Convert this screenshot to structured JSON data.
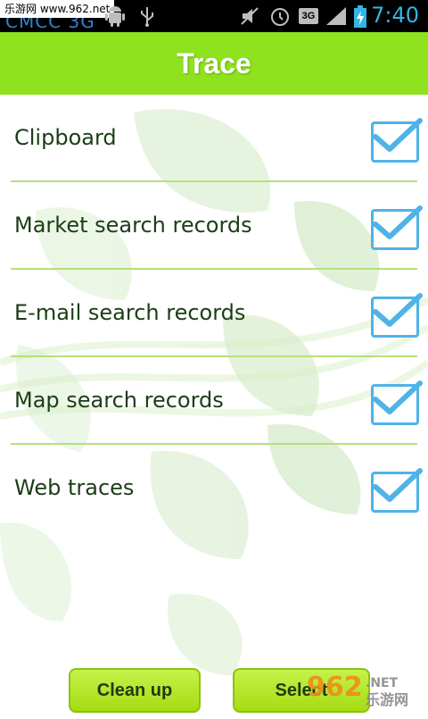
{
  "statusbar": {
    "watermark": "乐游网 www.962.net",
    "carrier": "CMCC 3G",
    "network_badge": "3G",
    "time": "7:40",
    "icons": [
      "android-icon",
      "usb-icon",
      "mute-icon",
      "alarm-icon",
      "signal-icon",
      "battery-charging-icon"
    ]
  },
  "header": {
    "title": "Trace"
  },
  "items": [
    {
      "label": "Clipboard",
      "checked": true
    },
    {
      "label": "Market search records",
      "checked": true
    },
    {
      "label": "E-mail search records",
      "checked": true
    },
    {
      "label": "Map search records",
      "checked": true
    },
    {
      "label": "Web traces",
      "checked": true
    }
  ],
  "footer": {
    "clean_label": "Clean up",
    "select_label": "Select"
  },
  "logo": {
    "text_top": "962",
    "text_bottom": "乐游网",
    "text_net": ".NET"
  },
  "colors": {
    "accent": "#8fe21e",
    "checkbox": "#4fb3e8",
    "clock": "#33b5e5"
  }
}
